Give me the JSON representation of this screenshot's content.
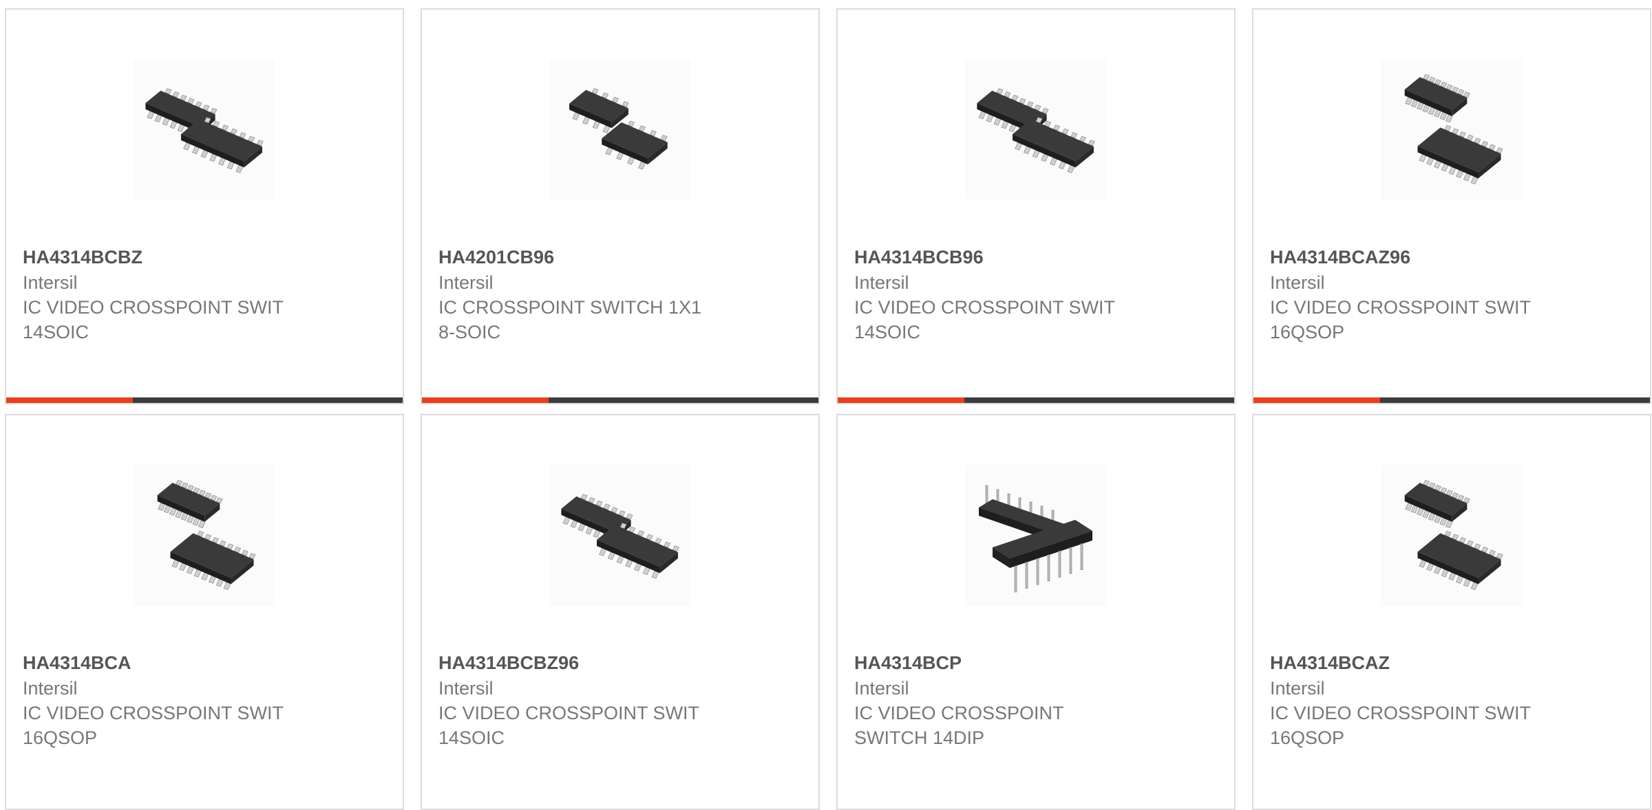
{
  "colors": {
    "accent": "#e8401c",
    "bar_track": "#3c3c3c",
    "card_border": "#dcdcdc",
    "title_text": "#555555",
    "body_text": "#777777"
  },
  "products": [
    {
      "part_number": "HA4314BCBZ",
      "manufacturer": "Intersil",
      "description_line1": "IC VIDEO CROSSPOINT SWIT",
      "description_line2": "14SOIC",
      "image_icon": "soic-14-chip-icon",
      "progress": 0.32
    },
    {
      "part_number": "HA4201CB96",
      "manufacturer": "Intersil",
      "description_line1": "IC CROSSPOINT SWITCH 1X1",
      "description_line2": "8-SOIC",
      "image_icon": "soic-8-chip-icon",
      "progress": 0.32
    },
    {
      "part_number": "HA4314BCB96",
      "manufacturer": "Intersil",
      "description_line1": "IC VIDEO CROSSPOINT SWIT",
      "description_line2": "14SOIC",
      "image_icon": "soic-14-chip-icon",
      "progress": 0.32
    },
    {
      "part_number": "HA4314BCAZ96",
      "manufacturer": "Intersil",
      "description_line1": "IC VIDEO CROSSPOINT SWIT",
      "description_line2": "16QSOP",
      "image_icon": "qsop-16-chip-icon",
      "progress": 0.32
    },
    {
      "part_number": "HA4314BCA",
      "manufacturer": "Intersil",
      "description_line1": "IC VIDEO CROSSPOINT SWIT",
      "description_line2": "16QSOP",
      "image_icon": "qsop-16-chip-icon"
    },
    {
      "part_number": "HA4314BCBZ96",
      "manufacturer": "Intersil",
      "description_line1": "IC VIDEO CROSSPOINT SWIT",
      "description_line2": "14SOIC",
      "image_icon": "soic-14-chip-icon"
    },
    {
      "part_number": "HA4314BCP",
      "manufacturer": "Intersil",
      "description_line1": "IC VIDEO CROSSPOINT",
      "description_line2": "SWITCH 14DIP",
      "image_icon": "dip-14-chip-icon"
    },
    {
      "part_number": "HA4314BCAZ",
      "manufacturer": "Intersil",
      "description_line1": "IC VIDEO CROSSPOINT SWIT",
      "description_line2": "16QSOP",
      "image_icon": "qsop-16-chip-icon"
    }
  ]
}
